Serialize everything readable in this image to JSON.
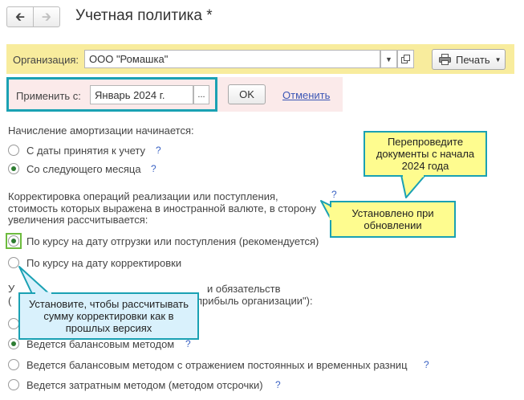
{
  "header": {
    "back_icon": "arrow-left-icon",
    "forward_icon": "arrow-right-icon",
    "title": "Учетная политика *"
  },
  "org": {
    "label": "Организация:",
    "value": "ООО \"Ромашка\"",
    "print_label": "Печать"
  },
  "apply": {
    "label": "Применить с:",
    "value": "Январь 2024 г.",
    "dots": "...",
    "ok": "OK",
    "cancel": "Отменить"
  },
  "depreciation": {
    "heading": "Начисление амортизации начинается:",
    "options": [
      {
        "label": "С даты принятия к учету",
        "selected": false
      },
      {
        "label": "Со следующего месяца",
        "selected": true
      }
    ]
  },
  "adjustment": {
    "heading_lines": [
      "Корректировка операций реализации или поступления,",
      "стоимость которых выражена в иностранной валюте, в сторону",
      "увеличения рассчитывается:"
    ],
    "options": [
      {
        "label": "По курсу на дату отгрузки или поступления (рекомендуется)",
        "selected": true
      },
      {
        "label": "По курсу на дату корректировки",
        "selected": false
      }
    ]
  },
  "accounting": {
    "heading_line1": "У",
    "heading_line1_right": "и обязательств",
    "heading_line2_left": "(",
    "heading_line2_right": "прибыль организации\"):",
    "options": [
      {
        "label": "",
        "selected": false
      },
      {
        "label": "Ведется балансовым методом",
        "selected": true
      },
      {
        "label": "Ведется балансовым методом с отражением постоянных и временных разниц",
        "selected": false
      },
      {
        "label": "Ведется затратным методом (методом отсрочки)",
        "selected": false
      }
    ]
  },
  "help": "?",
  "callouts": {
    "repost": "Перепроведите документы с начала 2024 года",
    "installed": "Установлено при обновлении",
    "set_to_calc": "Установите, чтобы рассчитывать сумму корректировки как в прошлых версиях"
  },
  "colors": {
    "org_bar": "#f8ec9d",
    "apply_frame": "#1aa1b3",
    "callout_yellow": "#fefc8f",
    "callout_blue": "#d9f1fc",
    "radio_selected": "#2e7d32",
    "radio_frame": "#6dbb3e"
  }
}
